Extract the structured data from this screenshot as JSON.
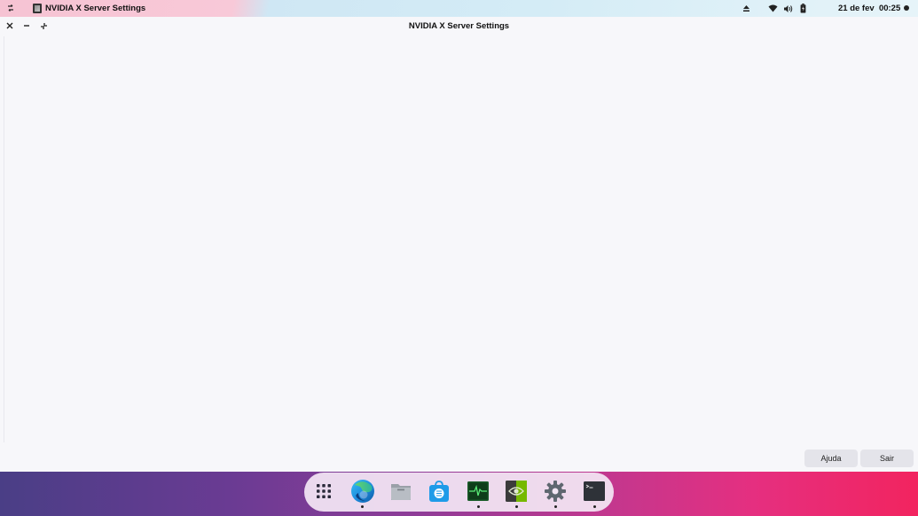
{
  "top_bar": {
    "activities_icon": "activities-icon",
    "app_icon": "nvidia-settings-app-icon",
    "app_name": "NVIDIA X Server Settings",
    "tray_icons": [
      "eject-icon",
      "wifi-icon",
      "volume-icon",
      "battery-icon"
    ],
    "clock": "21 de fev  00:25",
    "status_icon": "notification-dot-icon"
  },
  "window": {
    "title": "NVIDIA X Server Settings",
    "controls": [
      "close-icon",
      "minimize-icon",
      "restore-icon"
    ],
    "buttons": {
      "help": "Ajuda",
      "quit": "Sair"
    }
  },
  "dock": {
    "items": [
      {
        "name": "app-grid",
        "icon": "app-grid-icon",
        "running": false
      },
      {
        "name": "edge-browser",
        "icon": "edge-icon",
        "running": true
      },
      {
        "name": "files",
        "icon": "folder-icon",
        "running": false
      },
      {
        "name": "software-store",
        "icon": "store-bag-icon",
        "running": false
      },
      {
        "name": "system-monitor",
        "icon": "system-monitor-icon",
        "running": true
      },
      {
        "name": "nvidia-settings",
        "icon": "nvidia-icon",
        "running": true
      },
      {
        "name": "settings",
        "icon": "gear-icon",
        "running": true
      },
      {
        "name": "terminal",
        "icon": "terminal-icon",
        "running": true
      }
    ]
  },
  "colors": {
    "window_bg": "#f7f7fa",
    "button_bg": "#e4e4ea",
    "nvidia_green": "#76b900",
    "store_blue": "#1e9be8"
  }
}
